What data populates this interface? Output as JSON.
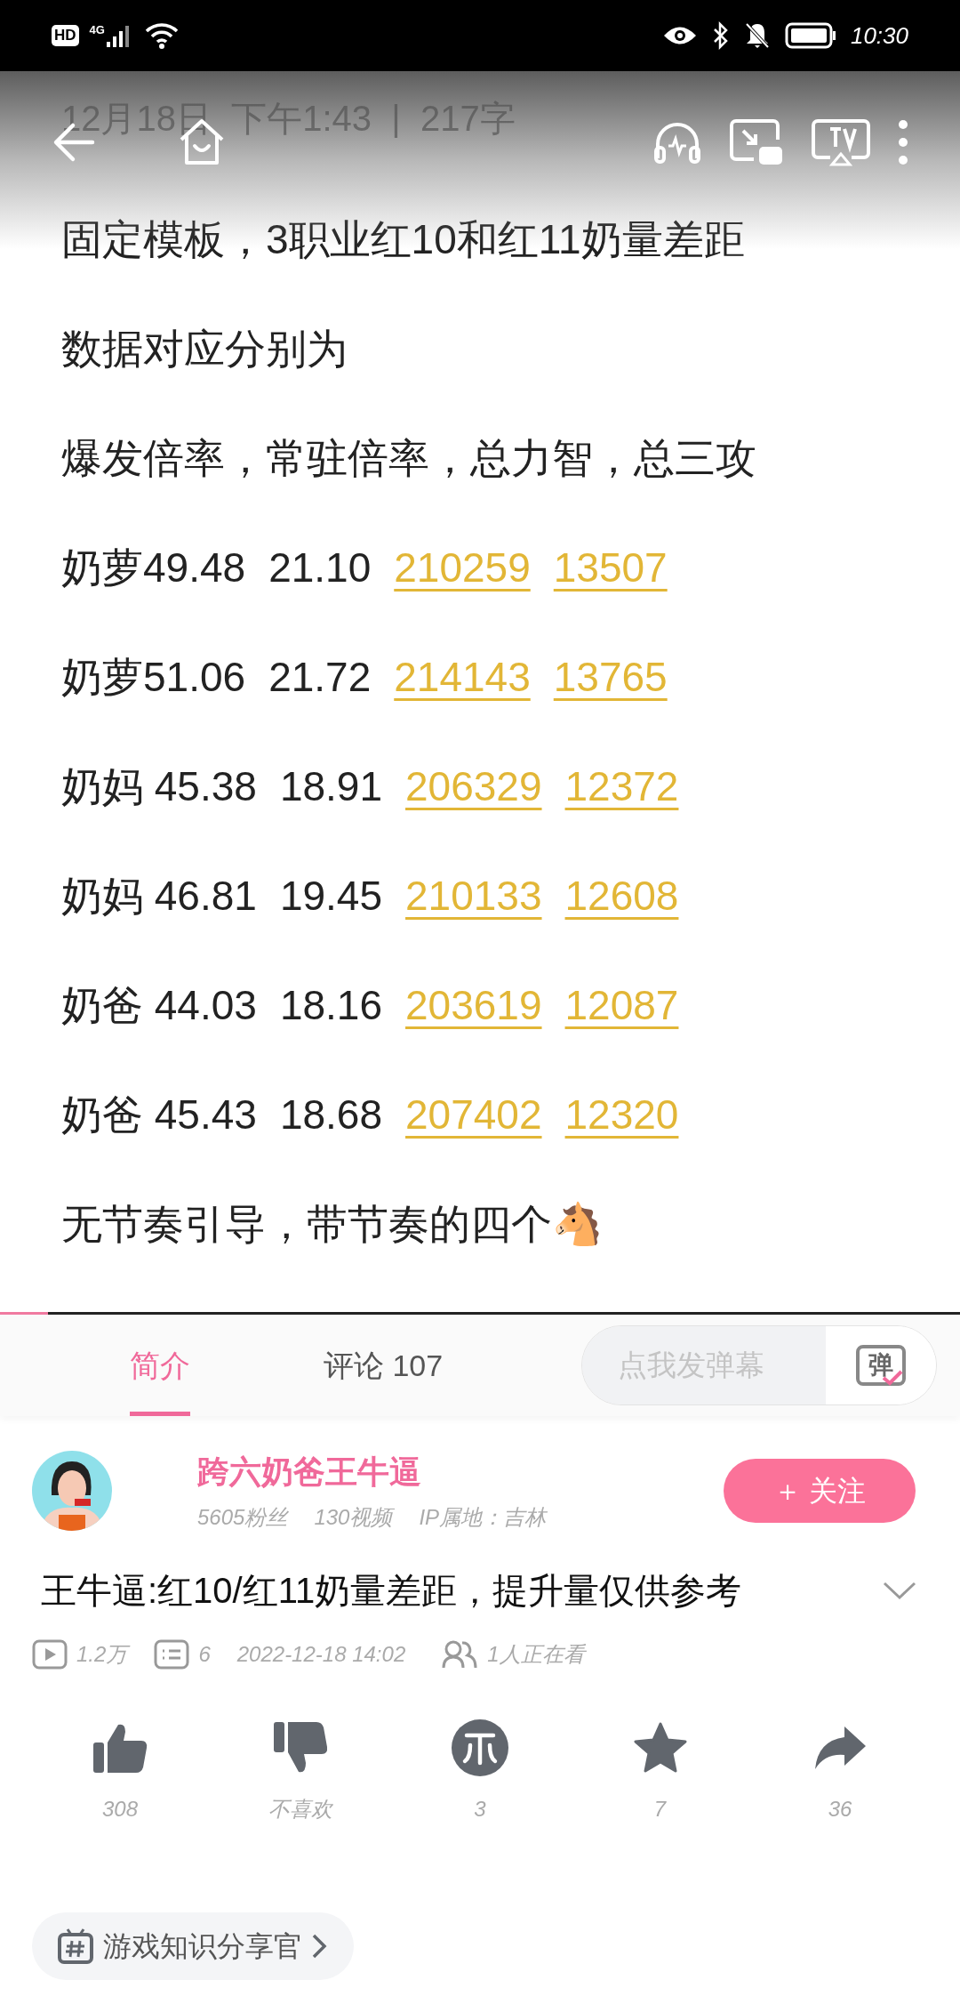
{
  "status_bar": {
    "badge": "HD",
    "network": "4G",
    "time": "10:30"
  },
  "video": {
    "progress": {
      "level": 0.05
    },
    "note": {
      "header": "12月18日  下午1:43  |  217字",
      "lines": [
        {
          "kind": "text",
          "text": "固定模板，3职业红10和红11奶量差距"
        },
        {
          "kind": "text",
          "text": "数据对应分别为"
        },
        {
          "kind": "text",
          "text": "爆发倍率，常驻倍率，总力智，总三攻"
        },
        {
          "kind": "row",
          "cells": [
            {
              "text": "奶萝49.48",
              "highlight": false
            },
            {
              "text": "21.10",
              "highlight": false
            },
            {
              "text": "210259",
              "highlight": true
            },
            {
              "text": "13507",
              "highlight": true
            }
          ]
        },
        {
          "kind": "row",
          "cells": [
            {
              "text": "奶萝51.06",
              "highlight": false
            },
            {
              "text": "21.72",
              "highlight": false
            },
            {
              "text": "214143",
              "highlight": true
            },
            {
              "text": "13765",
              "highlight": true
            }
          ]
        },
        {
          "kind": "row",
          "cells": [
            {
              "text": "奶妈 45.38",
              "highlight": false
            },
            {
              "text": "18.91",
              "highlight": false
            },
            {
              "text": "206329",
              "highlight": true
            },
            {
              "text": "12372",
              "highlight": true
            }
          ]
        },
        {
          "kind": "row",
          "cells": [
            {
              "text": "奶妈 46.81",
              "highlight": false
            },
            {
              "text": "19.45",
              "highlight": false
            },
            {
              "text": "210133",
              "highlight": true
            },
            {
              "text": "12608",
              "highlight": true
            }
          ]
        },
        {
          "kind": "row",
          "cells": [
            {
              "text": "奶爸 44.03",
              "highlight": false
            },
            {
              "text": "18.16",
              "highlight": false
            },
            {
              "text": "203619",
              "highlight": true
            },
            {
              "text": "12087",
              "highlight": true
            }
          ]
        },
        {
          "kind": "row",
          "cells": [
            {
              "text": "奶爸 45.43",
              "highlight": false
            },
            {
              "text": "18.68",
              "highlight": false
            },
            {
              "text": "207402",
              "highlight": true
            },
            {
              "text": "12320",
              "highlight": true
            }
          ]
        },
        {
          "kind": "text",
          "text": "无节奏引导，带节奏的四个🐴"
        }
      ]
    }
  },
  "tabs": [
    {
      "label": "简介",
      "selected": true
    },
    {
      "label": "评论",
      "count": "107",
      "selected": false
    }
  ],
  "danmaku": {
    "placeholder": "点我发弹幕",
    "icon_text": "弹"
  },
  "author": {
    "name": "跨六奶爸王牛逼",
    "stats": [
      "5605粉丝",
      "130视频",
      "IP属地：吉林"
    ],
    "follow": "＋ 关注"
  },
  "title": "王牛逼:红10/红11奶量差距，提升量仅供参考",
  "meta": {
    "views": "1.2万",
    "danmaku": "6",
    "date": "2022-12-18  14:02",
    "watching": "1人正在看"
  },
  "actions": [
    {
      "kind": "like",
      "label": "308"
    },
    {
      "kind": "dislike",
      "label": "不喜欢"
    },
    {
      "kind": "coin",
      "label": "3"
    },
    {
      "kind": "favorite",
      "label": "7"
    },
    {
      "kind": "share",
      "label": "36"
    }
  ],
  "tag": "游戏知识分享官"
}
